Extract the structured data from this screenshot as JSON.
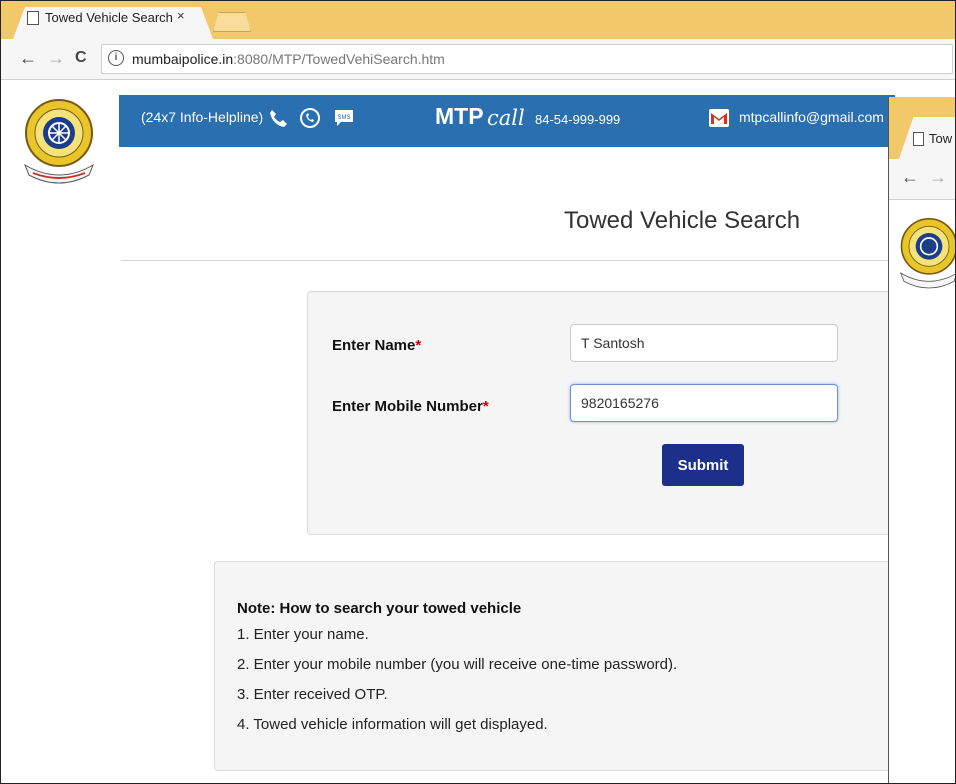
{
  "browser": {
    "tab_title": "Towed Vehicle Search",
    "tab_close": "×",
    "url_host": "mumbaipolice.in",
    "url_path": ":8080/MTP/TowedVehiSearch.htm",
    "back": "←",
    "forward": "→",
    "reload": "C",
    "info": "i"
  },
  "header": {
    "helpline": "(24x7 Info-Helpline)",
    "brand": "MTP",
    "brand_call": "call",
    "call_number": "84-54-999-999",
    "email": "mtpcallinfo@gmail.com",
    "banner_color": "#2a6fb0"
  },
  "page": {
    "title": "Towed Vehicle Search"
  },
  "form": {
    "name_label": "Enter Name",
    "mobile_label": "Enter Mobile Number",
    "required_mark": "*",
    "name_value": "T Santosh",
    "mobile_value": "9820165276",
    "submit_label": "Submit",
    "submit_color": "#1c2f8a"
  },
  "note": {
    "heading": "Note: How to search your towed vehicle",
    "steps": [
      "1. Enter your name.",
      "2. Enter your mobile number (you will receive one-time password).",
      "3. Enter received OTP.",
      "4. Towed vehicle information will get displayed."
    ]
  },
  "second_window": {
    "tab_title": "Tow",
    "back": "←",
    "forward": "→"
  }
}
